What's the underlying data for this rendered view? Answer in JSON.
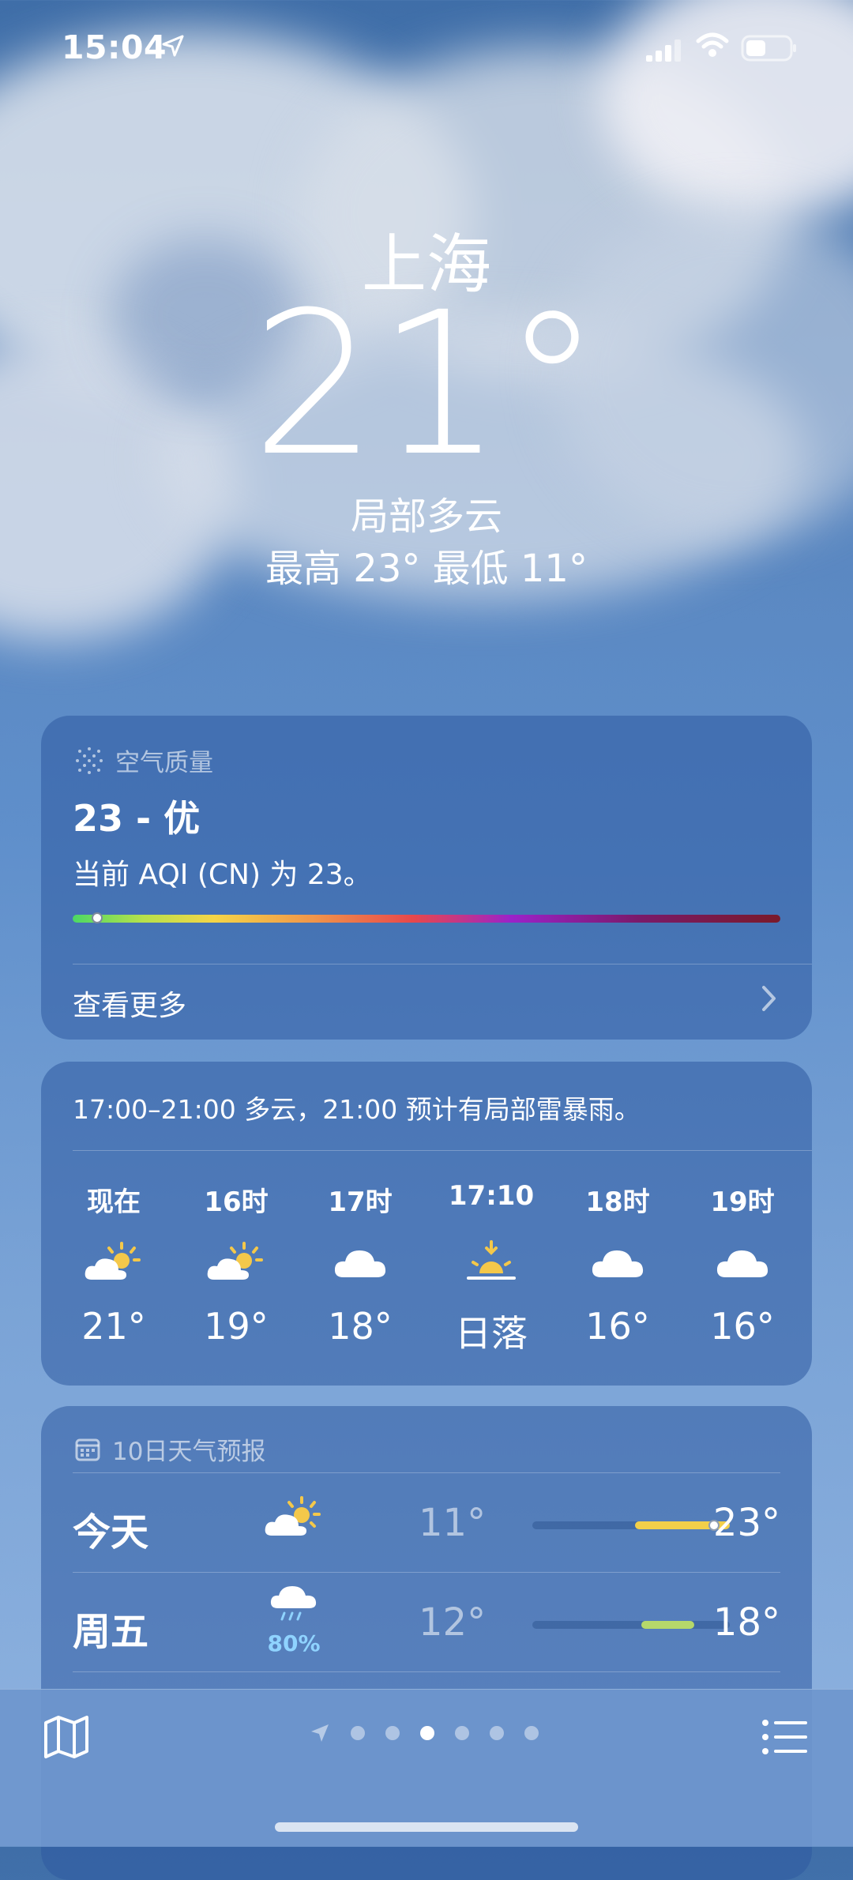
{
  "status_bar": {
    "time": "15:04"
  },
  "current": {
    "city": "上海",
    "temperature": "21°",
    "condition": "局部多云",
    "high_low": "最高 23°  最低 11°"
  },
  "air_quality": {
    "header": "空气质量",
    "value": "23 - 优",
    "description": "当前 AQI (CN) 为 23。",
    "level_fraction": 0.035,
    "more_label": "查看更多",
    "gradient_colors": [
      "#4cd964",
      "#f5d547",
      "#e8484b",
      "#9b22c9",
      "#7a1a2a"
    ]
  },
  "hourly": {
    "summary": "17:00–21:00 多云，21:00 预计有局部雷暴雨。",
    "items": [
      {
        "label": "现在",
        "icon": "partly-cloudy-sun-icon",
        "value": "21°"
      },
      {
        "label": "16时",
        "icon": "partly-cloudy-sun-icon",
        "value": "19°"
      },
      {
        "label": "17时",
        "icon": "cloud-icon",
        "value": "18°"
      },
      {
        "label": "17:10",
        "icon": "sunset-icon",
        "value": "日落"
      },
      {
        "label": "18时",
        "icon": "cloud-icon",
        "value": "16°"
      },
      {
        "label": "19时",
        "icon": "cloud-icon",
        "value": "16°"
      }
    ]
  },
  "daily": {
    "header": "10日天气预报",
    "days": [
      {
        "name": "今天",
        "icon": "partly-cloudy-sun-icon",
        "precip": "",
        "low": "11°",
        "high": "23°",
        "range_start": 0.52,
        "range_end": 1.0,
        "color": "#f2cf4a",
        "now_at": 0.92
      },
      {
        "name": "周五",
        "icon": "rain-cloud-icon",
        "precip": "80%",
        "low": "12°",
        "high": "18°",
        "range_start": 0.55,
        "range_end": 0.82,
        "color": "#b6d86a",
        "now_at": null
      }
    ]
  },
  "pager": {
    "pages": 6,
    "active": 2
  }
}
